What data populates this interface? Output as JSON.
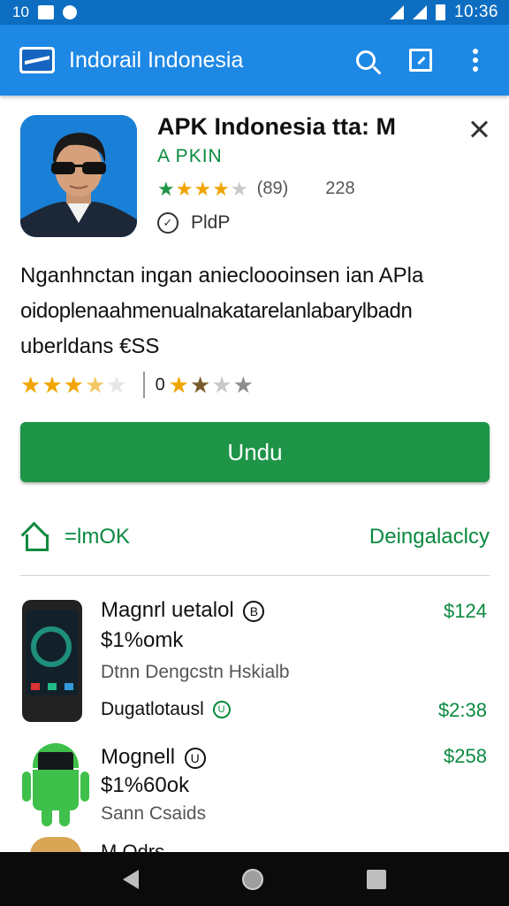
{
  "status_bar": {
    "left_text": "10",
    "time": "10:36"
  },
  "app_bar": {
    "title": "Indorail Indonesia",
    "logo_icon": "train-logo-icon",
    "actions": [
      "search-icon",
      "open-in-new-icon",
      "more-vert-icon"
    ]
  },
  "app": {
    "name": "APK Indonesia tta: M",
    "developer": "A PKIN",
    "rating_stars": 3.5,
    "rating_count": "(89)",
    "downloads": "228",
    "badge_text": "PldP",
    "description": [
      "Nganhnctan ingan aniecloooinsen ian APla",
      "oidoplenaahmenualnakatarelanlabarylbadn",
      "uberldans €SS"
    ],
    "review_zero": "0"
  },
  "download_button": {
    "label": "Undu"
  },
  "section": {
    "label": "=lmOK",
    "link": "Deingalaclcy"
  },
  "list": [
    {
      "title": "Magnrl uetalol",
      "title_badge": "B",
      "subtitle": "$1%omk",
      "meta": "Dtnn Dengcstn Hskialb",
      "extra": "Dugatlotausl",
      "extra_badge": "U",
      "price": "$124",
      "extra_price": "$2:38"
    },
    {
      "title": "Mognell",
      "title_badge": "U",
      "subtitle": "$1%60ok",
      "meta": "Sann Csaids",
      "price": "$258"
    }
  ],
  "partial_item": {
    "title": "M Odrs ..."
  },
  "colors": {
    "app_bar": "#1e88e5",
    "status_bar": "#0d6ec1",
    "accent_green": "#1e9447",
    "text_green": "#0a8a3f",
    "star": "#f0a500"
  }
}
